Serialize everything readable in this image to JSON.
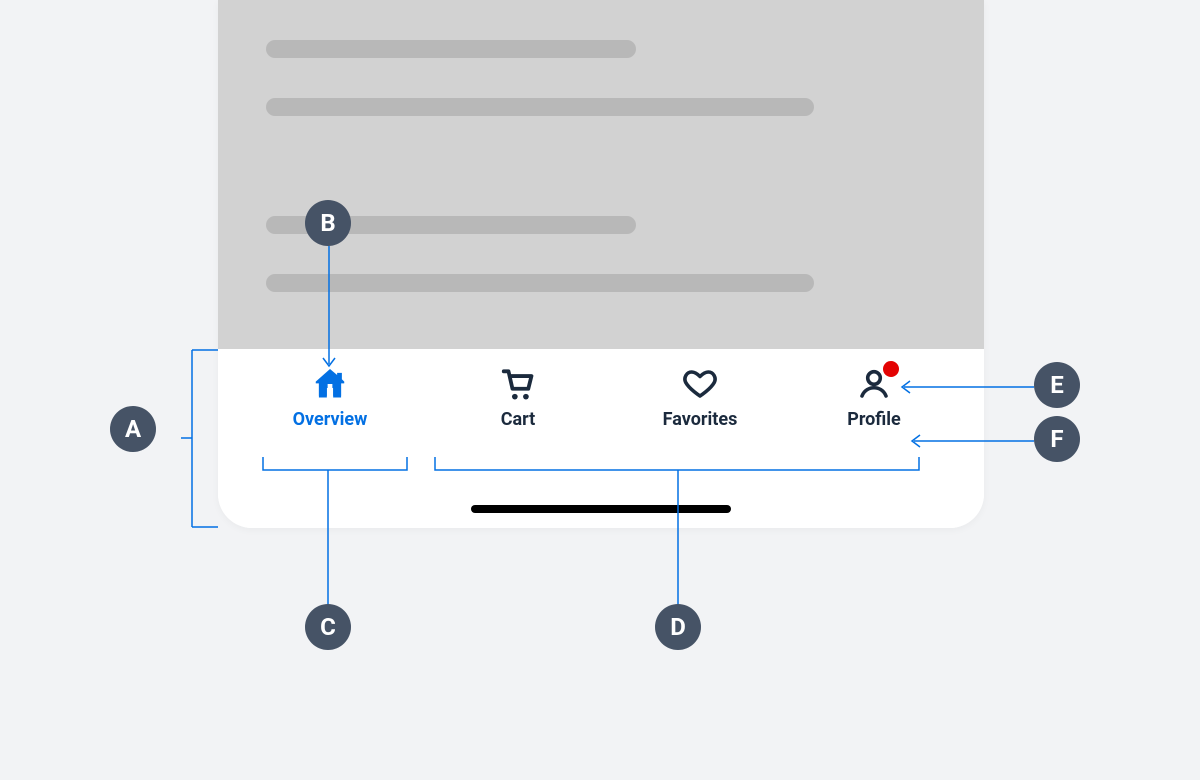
{
  "callouts": {
    "A": "A",
    "B": "B",
    "C": "C",
    "D": "D",
    "E": "E",
    "F": "F"
  },
  "tabbar": {
    "items": [
      {
        "label": "Overview",
        "icon": "home-icon",
        "active": true,
        "badge": false
      },
      {
        "label": "Cart",
        "icon": "cart-icon",
        "active": false,
        "badge": false
      },
      {
        "label": "Favorites",
        "icon": "heart-icon",
        "active": false,
        "badge": false
      },
      {
        "label": "Profile",
        "icon": "profile-icon",
        "active": false,
        "badge": true
      }
    ]
  },
  "colors": {
    "active": "#0370e3",
    "inactive": "#1b2a3d",
    "badge": "#e30303",
    "calloutBg": "#465366"
  }
}
